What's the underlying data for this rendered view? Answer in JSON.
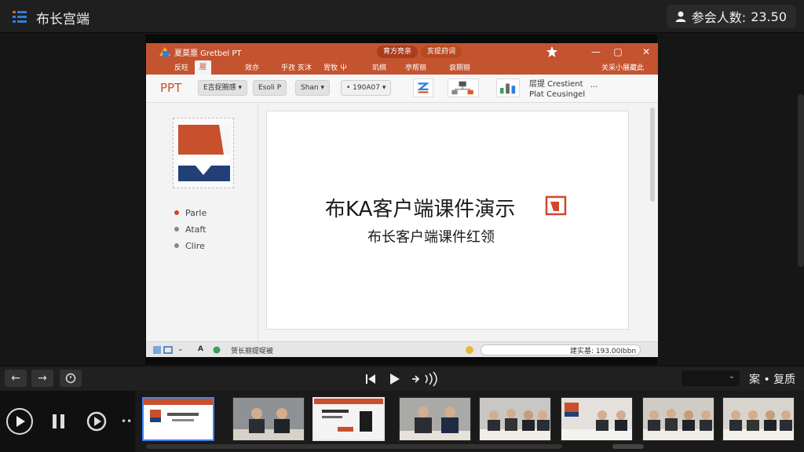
{
  "app": {
    "title": "布长宫端",
    "participants_label": "参会人数:",
    "participants_value": "23.50"
  },
  "ppt": {
    "window_title": "夏莫噩 Gretbel PT",
    "header_pills": [
      "育方亮亲",
      "亥提荮词"
    ],
    "tabs": [
      "反旺",
      "腥",
      "效亦",
      "乎孜 亥沐",
      "胃牧 屮",
      "玑棋",
      "亭帮丽",
      "衰期丽",
      "关采小展藏此"
    ],
    "ribbon": {
      "logo_text": "PPT",
      "dropdown1": "E吉捉腕感",
      "btn2": "Esoli P",
      "btn3": "Shan",
      "zoom": "• 190A07",
      "right_text_line1": "层提 Crestient",
      "right_text_line2": "Plat Ceusingel",
      "ellipsis": "..."
    },
    "left_pane": {
      "bullets": [
        "Parle",
        "Ataft",
        "Clire"
      ]
    },
    "slide": {
      "title": "布KA客户端课件演示",
      "subtitle": "布长客户端课件红领"
    },
    "status": {
      "left_text": "贺长丽提哫被",
      "right_text": "建实基: 193.00Ibbn"
    }
  },
  "controls": {
    "quality_label": "案 • 复质"
  },
  "colors": {
    "accent_ppt": "#c4532f",
    "selected_border": "#3b82f6"
  }
}
